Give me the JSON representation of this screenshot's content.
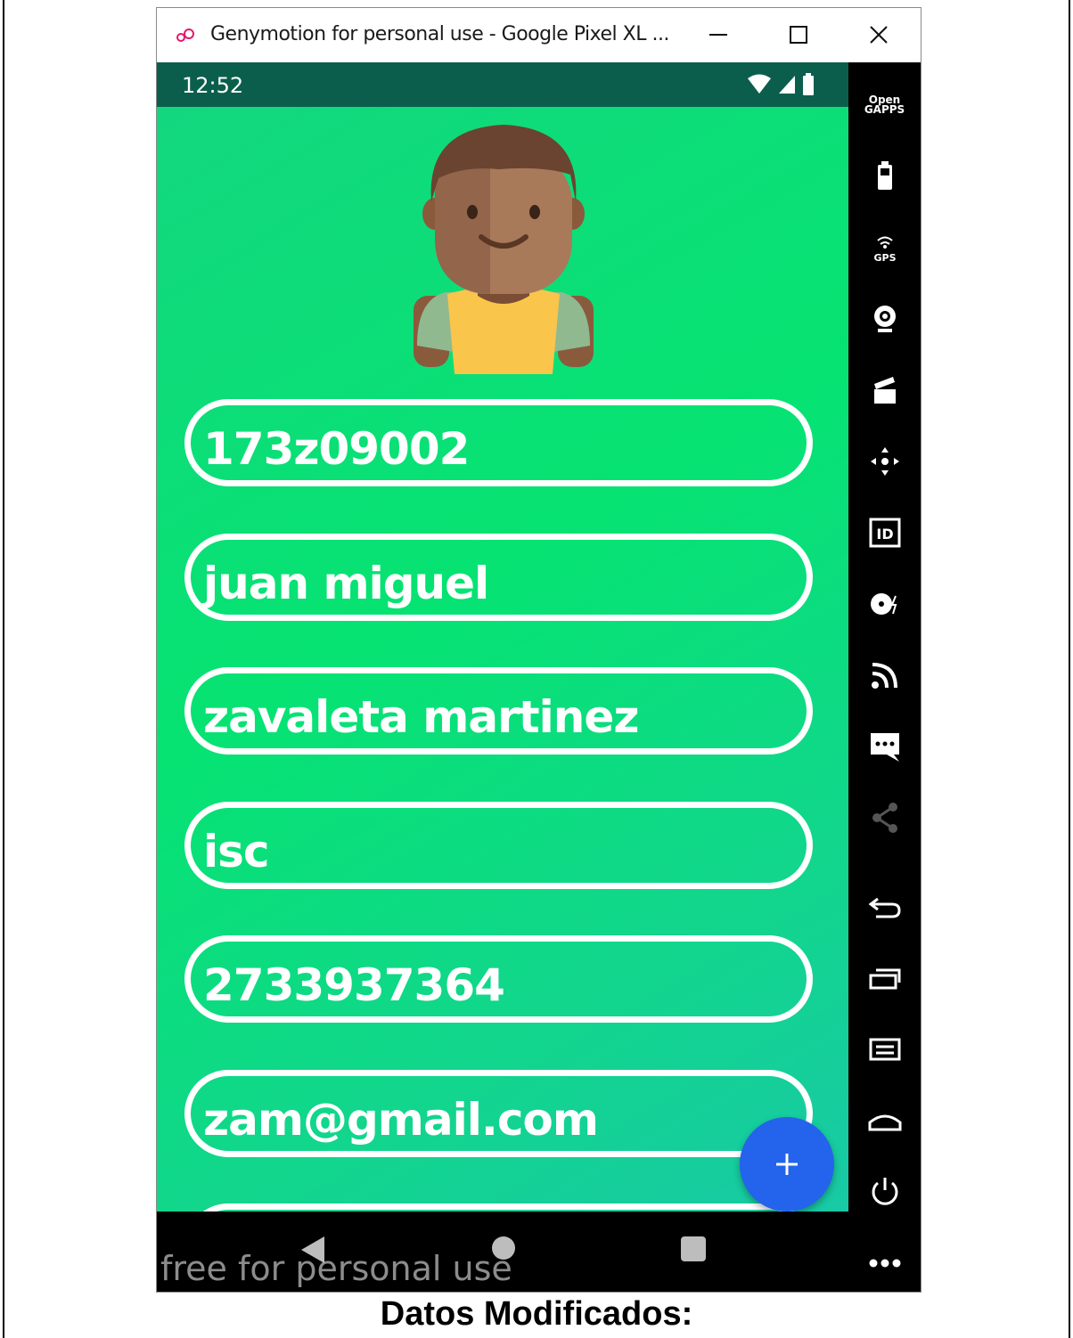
{
  "window": {
    "title": "Genymotion for personal use - Google Pixel XL ...",
    "minimize_icon": "minimize-icon",
    "maximize_icon": "maximize-icon",
    "close_icon": "close-icon"
  },
  "status_bar": {
    "time": "12:52",
    "icons": [
      "wifi-icon",
      "signal-icon",
      "battery-icon"
    ]
  },
  "form": {
    "fields": [
      {
        "value": "173z09002"
      },
      {
        "value": "juan miguel"
      },
      {
        "value": "zavaleta martinez"
      },
      {
        "value": "isc"
      },
      {
        "value": "2733937364"
      },
      {
        "value": "zam@gmail.com"
      },
      {
        "value": ""
      }
    ]
  },
  "fab": {
    "label": "+"
  },
  "navbar": {
    "watermark": "free for personal use",
    "icons": [
      "back-icon",
      "home-icon",
      "recents-icon"
    ]
  },
  "sidebar": {
    "open_gapps_label": "Open GAPPS",
    "gps_label": "GPS",
    "id_label": "ID",
    "more_label": "..."
  },
  "caption": "Datos Modificados:",
  "colors": {
    "gradient_start": "#14d680",
    "gradient_end": "#18c9a6",
    "status_bar": "#0b5e4c",
    "fab": "#2463ec"
  }
}
